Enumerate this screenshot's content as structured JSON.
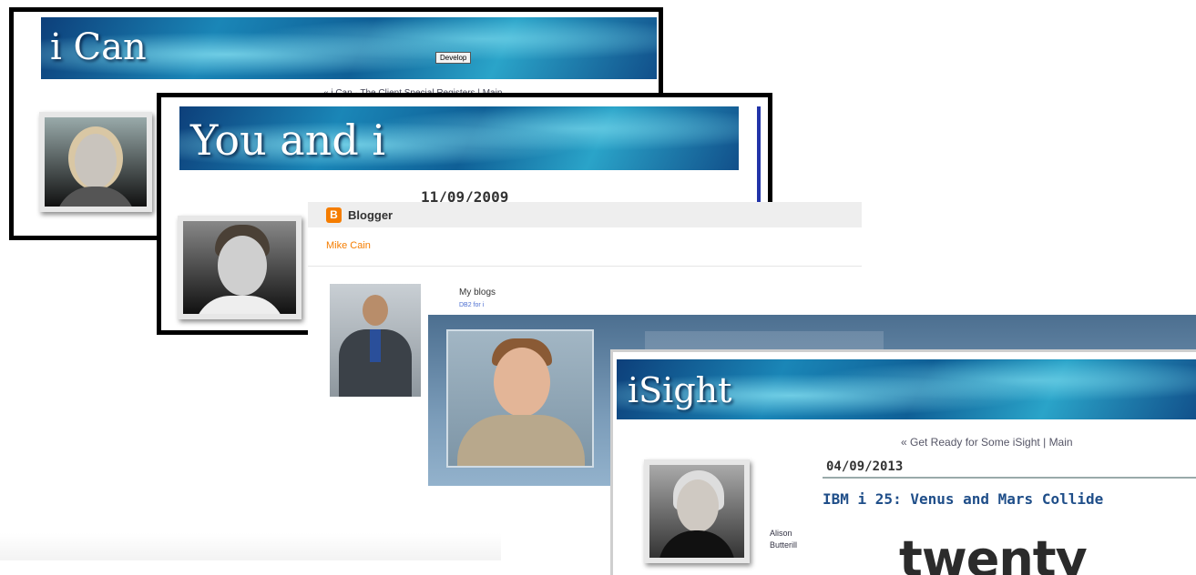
{
  "cards": {
    "ican": {
      "title": "i Can",
      "button_label": "Develop",
      "nav_text": "« i Can   ·   The Client Special Registers  |  Main"
    },
    "youandi": {
      "title": "You and i",
      "date": "11/09/2009"
    },
    "blogger": {
      "brand": "Blogger",
      "author": "Mike Cain",
      "my_blogs_label": "My blogs",
      "my_blogs_link": "DB2 for i"
    },
    "isight": {
      "title": "iSight",
      "nav_prev": "« Get Ready for Some iSight",
      "nav_sep": "|",
      "nav_main": "Main",
      "date": "04/09/2013",
      "post_title": "IBM i 25: Venus and Mars Collide",
      "author_line1": "Alison",
      "author_line2": "Butterill",
      "logo_text": "twenty"
    }
  },
  "colors": {
    "blogger_orange": "#f57d00",
    "isight_post_title": "#1f4e89",
    "frame_border": "#000000"
  },
  "icons": {
    "blogger_logo": "blogger-icon"
  }
}
